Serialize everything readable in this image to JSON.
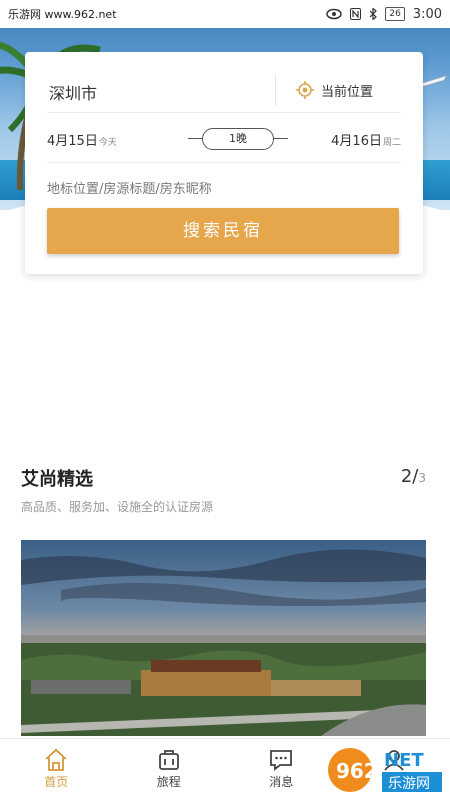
{
  "status_bar": {
    "watermark_text": "乐游网 www.962.net",
    "battery": "26",
    "time": "3:00"
  },
  "search": {
    "city": "深圳市",
    "locate_label": "当前位置",
    "checkin_date": "4月15日",
    "checkin_note": "今天",
    "nights": "1晚",
    "checkout_date": "4月16日",
    "checkout_note": "周二",
    "keyword_placeholder": "地标位置/房源标题/房东昵称",
    "search_button": "搜索民宿"
  },
  "featured": {
    "title": "艾尚精选",
    "page_current": "2/",
    "page_total": "3",
    "subtitle": "高品质、服务加、设施全的认证房源"
  },
  "tabbar": {
    "items": [
      {
        "label": "首页",
        "icon": "home-icon",
        "active": true
      },
      {
        "label": "旅程",
        "icon": "luggage-icon",
        "active": false
      },
      {
        "label": "消息",
        "icon": "message-icon",
        "active": false
      },
      {
        "label": "",
        "icon": "user-icon",
        "active": false
      }
    ]
  },
  "watermark": {
    "brand": "962",
    "suffix": "NET",
    "site": "乐游网"
  },
  "colors": {
    "accent": "#e5a64c",
    "active_tab": "#d39a3d"
  }
}
